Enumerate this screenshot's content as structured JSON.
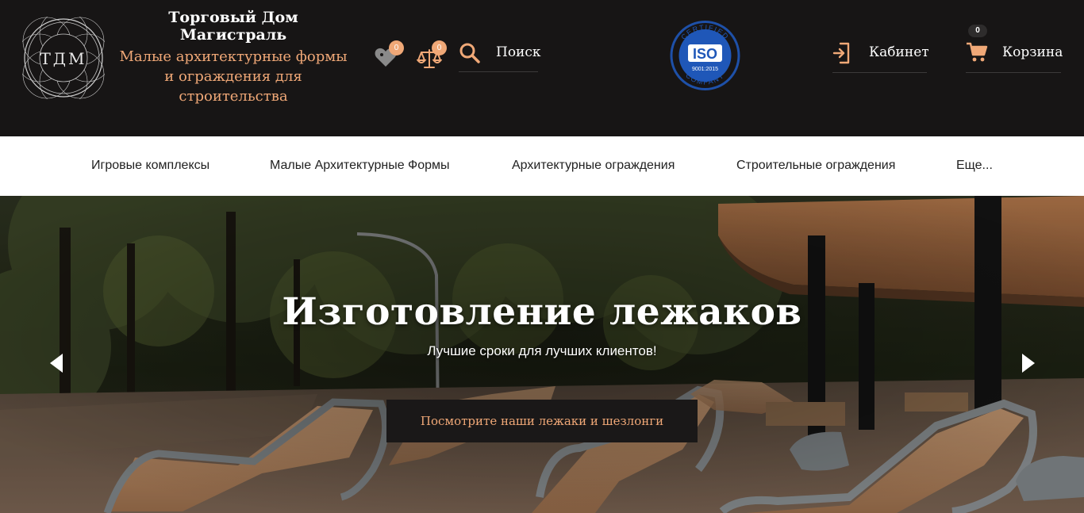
{
  "header": {
    "logo_text": "ТДМ",
    "brand_title": "Торговый Дом Магистраль",
    "brand_subtitle": "Малые архитектурные формы и ограждения для строительства",
    "favorites_count": "0",
    "compare_count": "0",
    "search_label": "Поиск",
    "iso_text": "ISO",
    "iso_top": "CERTIFIED",
    "iso_bottom": "COMPANY",
    "iso_std": "9001:2015",
    "cabinet_label": "Кабинет",
    "cart_label": "Корзина",
    "cart_count": "0"
  },
  "nav": {
    "items": [
      "Игровые комплексы",
      "Малые Архитектурные Формы",
      "Архитектурные ограждения",
      "Строительные ограждения",
      "Еще..."
    ]
  },
  "hero": {
    "title": "Изготовление лежаков",
    "subtitle": "Лучшие сроки для лучших клиентов!",
    "button_label": "Посмотрите наши лежаки и шезлонги"
  },
  "colors": {
    "header_bg": "#171515",
    "accent": "#f0a877",
    "iso_blue": "#1f57b8"
  }
}
